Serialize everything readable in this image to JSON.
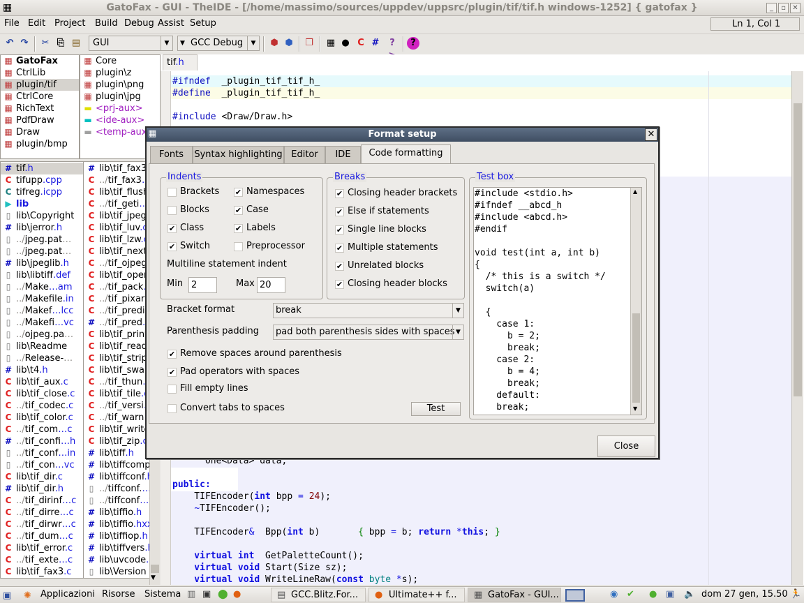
{
  "window": {
    "title": "GatoFax - GUI - TheIDE - [/home/massimo/sources/uppdev/uppsrc/plugin/tif/tif.h windows-1252] { gatofax }"
  },
  "menu": [
    "File",
    "Edit",
    "Project",
    "Build",
    "Debug",
    "Assist",
    "Setup"
  ],
  "status": {
    "position": "Ln 1, Col 1"
  },
  "toolbar": {
    "main_config": "GUI",
    "build_method": "GCC Debug"
  },
  "packages": {
    "col1": [
      {
        "n": "GatoFax",
        "bold": true
      },
      {
        "n": "CtrlLib"
      },
      {
        "n": "plugin/tif",
        "sel": true
      },
      {
        "n": "CtrlCore"
      },
      {
        "n": "RichText"
      },
      {
        "n": "PdfDraw"
      },
      {
        "n": "Draw"
      },
      {
        "n": "plugin/bmp"
      }
    ],
    "col2": [
      {
        "n": "Core"
      },
      {
        "n": "plugin\\z"
      },
      {
        "n": "plugin\\png"
      },
      {
        "n": "plugin\\jpg"
      },
      {
        "n": "<prj-aux>",
        "aux": "#e0e000"
      },
      {
        "n": "<ide-aux>",
        "aux": "#00c0c0"
      },
      {
        "n": "<temp-aux>",
        "aux": "#a0a0a0"
      }
    ]
  },
  "files": {
    "col1": [
      {
        "i": "h",
        "p": "",
        "n": "tif",
        "e": ".h",
        "sel": true
      },
      {
        "i": "c",
        "p": "",
        "n": "tifupp",
        "e": ".cpp"
      },
      {
        "i": "ct",
        "p": "",
        "n": "tifreg",
        "e": ".icpp"
      },
      {
        "i": "sep",
        "p": "",
        "n": "lib",
        "e": ""
      },
      {
        "i": "f",
        "p": "",
        "n": "lib\\Copyright",
        "e": ""
      },
      {
        "i": "h",
        "p": "",
        "n": "lib\\jerror",
        "e": ".h"
      },
      {
        "i": "f",
        "p": "../",
        "n": "jpeg.pat",
        "e": "…",
        "d": true
      },
      {
        "i": "f",
        "p": "../",
        "n": "jpeg.pat",
        "e": "…",
        "d": true
      },
      {
        "i": "h",
        "p": "",
        "n": "lib\\jpeglib",
        "e": ".h"
      },
      {
        "i": "f",
        "p": "",
        "n": "lib\\libtiff",
        "e": ".def"
      },
      {
        "i": "f",
        "p": "../",
        "n": "Make",
        "e": "…am"
      },
      {
        "i": "f",
        "p": "../",
        "n": "Makefile",
        "e": ".in"
      },
      {
        "i": "f",
        "p": "../",
        "n": "Makef",
        "e": "…lcc"
      },
      {
        "i": "f",
        "p": "../",
        "n": "Makefi",
        "e": "…vc"
      },
      {
        "i": "f",
        "p": "../",
        "n": "ojpeg.pa",
        "e": "…",
        "d": true
      },
      {
        "i": "f",
        "p": "",
        "n": "lib\\Readme",
        "e": ""
      },
      {
        "i": "f",
        "p": "../",
        "n": "Release-",
        "e": "…",
        "d": true
      },
      {
        "i": "h",
        "p": "",
        "n": "lib\\t4",
        "e": ".h"
      },
      {
        "i": "c",
        "p": "",
        "n": "lib\\tif_aux",
        "e": ".c"
      },
      {
        "i": "c",
        "p": "",
        "n": "lib\\tif_close",
        "e": ".c"
      },
      {
        "i": "c",
        "p": "../",
        "n": "tif_codec",
        "e": ".c"
      },
      {
        "i": "c",
        "p": "",
        "n": "lib\\tif_color",
        "e": ".c"
      },
      {
        "i": "c",
        "p": "../",
        "n": "tif_com",
        "e": "…c"
      },
      {
        "i": "h",
        "p": "../",
        "n": "tif_confi",
        "e": "…h"
      },
      {
        "i": "f",
        "p": "../",
        "n": "tif_conf",
        "e": "…in"
      },
      {
        "i": "f",
        "p": "../",
        "n": "tif_con",
        "e": "…vc"
      },
      {
        "i": "c",
        "p": "",
        "n": "lib\\tif_dir",
        "e": ".c"
      },
      {
        "i": "h",
        "p": "",
        "n": "lib\\tif_dir",
        "e": ".h"
      },
      {
        "i": "c",
        "p": "../",
        "n": "tif_dirinf",
        "e": "…c"
      },
      {
        "i": "c",
        "p": "../",
        "n": "tif_dirre",
        "e": "…c"
      },
      {
        "i": "c",
        "p": "../",
        "n": "tif_dirwr",
        "e": "…c"
      },
      {
        "i": "c",
        "p": "../",
        "n": "tif_dum",
        "e": "…c"
      },
      {
        "i": "c",
        "p": "",
        "n": "lib\\tif_error",
        "e": ".c"
      },
      {
        "i": "c",
        "p": "../",
        "n": "tif_exte",
        "e": "…c"
      },
      {
        "i": "c",
        "p": "",
        "n": "lib\\tif_fax3",
        "e": ".c"
      }
    ],
    "col2": [
      {
        "i": "h",
        "p": "",
        "n": "lib\\tif_fax3",
        "e": ".h"
      },
      {
        "i": "c",
        "p": "../",
        "n": "tif_fax3",
        "e": "…c"
      },
      {
        "i": "c",
        "p": "",
        "n": "lib\\tif_flush",
        "e": ".c"
      },
      {
        "i": "c",
        "p": "../",
        "n": "tif_geti",
        "e": "…c"
      },
      {
        "i": "c",
        "p": "",
        "n": "lib\\tif_jpeg",
        "e": ".c"
      },
      {
        "i": "c",
        "p": "",
        "n": "lib\\tif_luv",
        "e": ".c"
      },
      {
        "i": "c",
        "p": "",
        "n": "lib\\tif_lzw",
        "e": ".c"
      },
      {
        "i": "c",
        "p": "",
        "n": "lib\\tif_next",
        "e": ".c"
      },
      {
        "i": "c",
        "p": "../",
        "n": "tif_ojpeg",
        "e": ".c"
      },
      {
        "i": "c",
        "p": "",
        "n": "lib\\tif_open",
        "e": ".c"
      },
      {
        "i": "c",
        "p": "../",
        "n": "tif_pack",
        "e": "…c"
      },
      {
        "i": "c",
        "p": "../",
        "n": "tif_pixar",
        "e": "…c"
      },
      {
        "i": "c",
        "p": "../",
        "n": "tif_predi",
        "e": "…c"
      },
      {
        "i": "h",
        "p": "../",
        "n": "tif_pred",
        "e": "…h"
      },
      {
        "i": "c",
        "p": "",
        "n": "lib\\tif_print",
        "e": ".c"
      },
      {
        "i": "c",
        "p": "",
        "n": "lib\\tif_read",
        "e": ".c"
      },
      {
        "i": "c",
        "p": "",
        "n": "lib\\tif_strip",
        "e": ".c"
      },
      {
        "i": "c",
        "p": "",
        "n": "lib\\tif_swab",
        "e": ".c"
      },
      {
        "i": "c",
        "p": "../",
        "n": "tif_thun",
        "e": "…c"
      },
      {
        "i": "c",
        "p": "",
        "n": "lib\\tif_tile",
        "e": ".c"
      },
      {
        "i": "c",
        "p": "../",
        "n": "tif_versi",
        "e": "…c"
      },
      {
        "i": "c",
        "p": "../",
        "n": "tif_warn",
        "e": "…c"
      },
      {
        "i": "c",
        "p": "",
        "n": "lib\\tif_write",
        "e": ".c"
      },
      {
        "i": "c",
        "p": "",
        "n": "lib\\tif_zip",
        "e": ".c"
      },
      {
        "i": "h",
        "p": "",
        "n": "lib\\tiff",
        "e": ".h"
      },
      {
        "i": "h",
        "p": "",
        "n": "lib\\tiffcomp",
        "e": ".h"
      },
      {
        "i": "h",
        "p": "",
        "n": "lib\\tiffconf",
        "e": ".h"
      },
      {
        "i": "f",
        "p": "../",
        "n": "tiffconf.",
        "e": "…in"
      },
      {
        "i": "f",
        "p": "../",
        "n": "tiffconf",
        "e": "…vc"
      },
      {
        "i": "h",
        "p": "",
        "n": "lib\\tiffio",
        "e": ".h"
      },
      {
        "i": "h",
        "p": "",
        "n": "lib\\tiffio",
        "e": ".hxx"
      },
      {
        "i": "h",
        "p": "",
        "n": "lib\\tiffiop",
        "e": ".h"
      },
      {
        "i": "h",
        "p": "",
        "n": "lib\\tiffvers",
        "e": ".h"
      },
      {
        "i": "h",
        "p": "",
        "n": "lib\\uvcode",
        "e": ".h"
      },
      {
        "i": "f",
        "p": "",
        "n": "lib\\Version",
        "e": ""
      }
    ]
  },
  "editor": {
    "tab": {
      "name": "tif",
      "ext": ".h"
    },
    "top_lines": [
      [
        [
          "pp",
          "#ifndef"
        ],
        [
          "",
          "  _plugin_tif_tif_h_"
        ]
      ],
      [
        [
          "pp",
          "#define"
        ],
        [
          "",
          "  _plugin_tif_tif_h_"
        ]
      ],
      [],
      [
        [
          "pp",
          "#include"
        ],
        [
          "",
          " <Draw/Draw.h>"
        ]
      ]
    ],
    "bottom_lines": [
      [
        [
          "",
          "      One<Data> data;"
        ]
      ],
      [],
      [
        [
          "kw",
          "public:"
        ]
      ],
      [
        [
          "",
          "    TIFEncoder("
        ],
        [
          "kw",
          "int"
        ],
        [
          "",
          " bpp "
        ],
        [
          "op",
          "="
        ],
        [
          "",
          " "
        ],
        [
          "num",
          "24"
        ],
        [
          "",
          ");"
        ]
      ],
      [
        [
          "",
          "    "
        ],
        [
          "op",
          "~"
        ],
        [
          "",
          "TIFEncoder();"
        ]
      ],
      [],
      [
        [
          "",
          "    TIFEncoder"
        ],
        [
          "op",
          "&"
        ],
        [
          "",
          "  Bpp("
        ],
        [
          "kw",
          "int"
        ],
        [
          "",
          " b)       "
        ],
        [
          "br",
          "{"
        ],
        [
          "",
          " bpp "
        ],
        [
          "op",
          "="
        ],
        [
          "",
          " b; "
        ],
        [
          "kw",
          "return"
        ],
        [
          "",
          " "
        ],
        [
          "op",
          "*"
        ],
        [
          "kw",
          "this"
        ],
        [
          "",
          "; "
        ],
        [
          "br",
          "}"
        ]
      ],
      [],
      [
        [
          "kw",
          "    virtual int"
        ],
        [
          "",
          "  GetPaletteCount();"
        ]
      ],
      [
        [
          "kw",
          "    virtual void"
        ],
        [
          "",
          " Start(Size sz);"
        ]
      ],
      [
        [
          "kw",
          "    virtual void"
        ],
        [
          "",
          " WriteLineRaw("
        ],
        [
          "kw",
          "const"
        ],
        [
          "",
          " "
        ],
        [
          "ty",
          "byte"
        ],
        [
          "",
          " "
        ],
        [
          "op",
          "*"
        ],
        [
          "",
          "s);"
        ]
      ]
    ]
  },
  "dialog": {
    "title": "Format setup",
    "tabs": [
      {
        "label": "Fonts"
      },
      {
        "label": "Syntax highlighting"
      },
      {
        "label": "Editor"
      },
      {
        "label": "IDE"
      },
      {
        "label": "Code formatting",
        "active": true
      }
    ],
    "indents": {
      "legend": "Indents",
      "options": [
        {
          "label": "Brackets",
          "checked": false
        },
        {
          "label": "Namespaces",
          "checked": true
        },
        {
          "label": "Blocks",
          "checked": false
        },
        {
          "label": "Case",
          "checked": true
        },
        {
          "label": "Class",
          "checked": true
        },
        {
          "label": "Labels",
          "checked": true
        },
        {
          "label": "Switch",
          "checked": true
        },
        {
          "label": "Preprocessor",
          "checked": false
        }
      ],
      "multiline_label": "Multiline statement indent",
      "min_label": "Min",
      "min_value": "2",
      "max_label": "Max",
      "max_value": "20"
    },
    "breaks": {
      "legend": "Breaks",
      "options": [
        {
          "label": "Closing header brackets",
          "checked": true
        },
        {
          "label": "Else if statements",
          "checked": true
        },
        {
          "label": "Single line blocks",
          "checked": true
        },
        {
          "label": "Multiple statements",
          "checked": true
        },
        {
          "label": "Unrelated blocks",
          "checked": true
        },
        {
          "label": "Closing header blocks",
          "checked": true
        }
      ]
    },
    "bracket_format": {
      "label": "Bracket format",
      "value": "break"
    },
    "parenthesis_padding": {
      "label": "Parenthesis padding",
      "value": "pad both parenthesis sides with spaces"
    },
    "options": [
      {
        "label": "Remove spaces around parenthesis",
        "checked": true
      },
      {
        "label": "Pad operators with spaces",
        "checked": true
      },
      {
        "label": "Fill empty lines",
        "checked": false
      },
      {
        "label": "Convert tabs to spaces",
        "checked": false
      }
    ],
    "test_button": "Test",
    "test_box": {
      "legend": "Test box",
      "text": "#include <stdio.h>\n#ifndef __abcd_h\n#include <abcd.h>\n#endif\n\nvoid test(int a, int b)\n{\n  /* this is a switch */\n  switch(a)\n\n  {\n    case 1:\n      b = 2;\n      break;\n    case 2:\n      b = 4;\n      break;\n    default:\n    break;"
    },
    "close_button": "Close"
  },
  "taskbar": {
    "menus": [
      "Applicazioni",
      "Risorse",
      "Sistema"
    ],
    "windows": [
      {
        "label": "GCC.Blitz.For..."
      },
      {
        "label": "Ultimate++ f..."
      },
      {
        "label": "GatoFax - GUI...",
        "active": true
      }
    ],
    "clock": "dom 27 gen, 15.50"
  }
}
